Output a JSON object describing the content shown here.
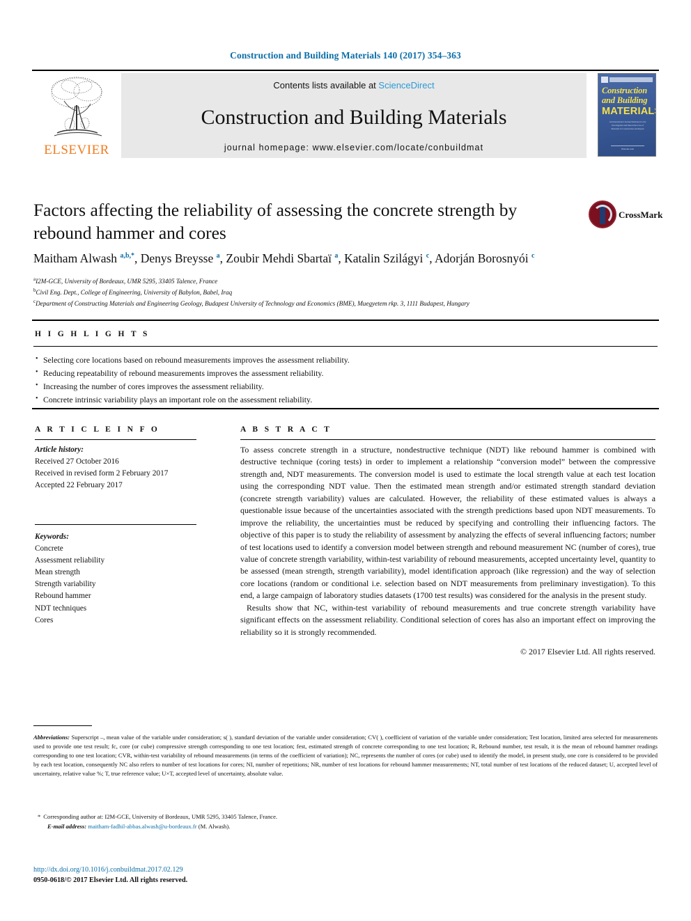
{
  "running_head": "Construction and Building Materials 140 (2017) 354–363",
  "masthead": {
    "publisher_name": "ELSEVIER",
    "contents_prefix": "Contents lists available at ",
    "contents_link": "ScienceDirect",
    "journal_title": "Construction and Building Materials",
    "homepage": "journal homepage: www.elsevier.com/locate/conbuildmat",
    "cover": {
      "line1": "Construction",
      "line2": "and Building",
      "line3": "MATERIALS",
      "blurb": "An International Journal Dedicated to the Investigation and Innovative Use of Materials in Construction and Repair",
      "bottom": "Elsevier.com"
    }
  },
  "crossmark": {
    "label": "CrossMark"
  },
  "article": {
    "title": "Factors affecting the reliability of assessing the concrete strength by rebound hammer and cores",
    "authors_html": "Maitham Alwash <sup>a,b,</sup><sup>*</sup>, Denys Breysse <sup>a</sup>, Zoubir Mehdi Sbartaï <sup>a</sup>, Katalin Szilágyi <sup>c</sup>, Adorján Borosnyói <sup>c</sup>",
    "affiliations": [
      {
        "mark": "a",
        "text": "I2M-GCE, University of Bordeaux, UMR 5295, 33405 Talence, France"
      },
      {
        "mark": "b",
        "text": "Civil Eng. Dept., College of Engineering, University of Babylon, Babel, Iraq"
      },
      {
        "mark": "c",
        "text": "Department of Constructing Materials and Engineering Geology, Budapest University of Technology and Economics (BME), Muegyetem rkp. 3, 1111 Budapest, Hungary"
      }
    ]
  },
  "highlights": {
    "heading": "H I G H L I G H T S",
    "items": [
      "Selecting core locations based on rebound measurements improves the assessment reliability.",
      "Reducing repeatability of rebound measurements improves the assessment reliability.",
      "Increasing the number of cores improves the assessment reliability.",
      "Concrete intrinsic variability plays an important role on the assessment reliability."
    ]
  },
  "article_info": {
    "heading": "A R T I C L E   I N F O",
    "history_label": "Article history:",
    "history": [
      "Received 27 October 2016",
      "Received in revised form 2 February 2017",
      "Accepted 22 February 2017"
    ],
    "keywords_label": "Keywords:",
    "keywords": [
      "Concrete",
      "Assessment reliability",
      "Mean strength",
      "Strength variability",
      "Rebound hammer",
      "NDT techniques",
      "Cores"
    ]
  },
  "abstract": {
    "heading": "A B S T R A C T",
    "paragraph1": "To assess concrete strength in a structure, nondestructive technique (NDT) like rebound hammer is combined with destructive technique (coring tests) in order to implement a relationship “conversion model” between the compressive strength and, NDT measurements. The conversion model is used to estimate the local strength value at each test location using the corresponding NDT value. Then the estimated mean strength and/or estimated strength standard deviation (concrete strength variability) values are calculated. However, the reliability of these estimated values is always a questionable issue because of the uncertainties associated with the strength predictions based upon NDT measurements. To improve the reliability, the uncertainties must be reduced by specifying and controlling their influencing factors. The objective of this paper is to study the reliability of assessment by analyzing the effects of several influencing factors; number of test locations used to identify a conversion model between strength and rebound measurement NC (number of cores), true value of concrete strength variability, within-test variability of rebound measurements, accepted uncertainty level, quantity to be assessed (mean strength, strength variability), model identification approach (like regression) and the way of selection core locations (random or conditional i.e. selection based on NDT measurements from preliminary investigation). To this end, a large campaign of laboratory studies datasets (1700 test results) was considered for the analysis in the present study.",
    "paragraph2": "Results show that NC, within-test variability of rebound measurements and true concrete strength variability have significant effects on the assessment reliability. Conditional selection of cores has also an important effect on improving the reliability so it is strongly recommended.",
    "copyright": "© 2017 Elsevier Ltd. All rights reserved."
  },
  "footnotes": {
    "abbreviations_label": "Abbreviations:",
    "abbreviations_text": "Superscript –, mean value of the variable under consideration; s( ), standard deviation of the variable under consideration; CV( ), coefficient of variation of the variable under consideration; Test location, limited area selected for measurements used to provide one test result; fc, core (or cube) compressive strength corresponding to one test location; fest, estimated strength of concrete corresponding to one test location; R, Rebound number, test result, it is the mean of rebound hammer readings corresponding to one test location; CVR, within-test variability of rebound measurements (in terms of the coefficient of variation); NC, represents the number of cores (or cube) used to identify the model, in present study, one core is considered to be provided by each test location, consequently NC also refers to number of test locations for cores; NI, number of repetitions; NR, number of test locations for rebound hammer measurements; NT, total number of test locations of the reduced dataset; U, accepted level of uncertainty, relative value %; T, true reference value; U×T, accepted level of uncertainty, absolute value.",
    "corresponding": "Corresponding author at: I2M-GCE, University of Bordeaux, UMR 5295, 33405 Talence, France.",
    "email_label": "E-mail address:",
    "email": "maitham-fadhil-abbas.alwash@u-bordeaux.fr",
    "email_suffix": "(M. Alwash)."
  },
  "doi": {
    "url": "http://dx.doi.org/10.1016/j.conbuildmat.2017.02.129",
    "issn_line": "0950-0618/© 2017 Elsevier Ltd. All rights reserved."
  },
  "colors": {
    "link": "#0b6ea8",
    "sciencedirect": "#2b9ad6",
    "elsevier_orange": "#ef7d21",
    "cover_blue": "#3c5c9a",
    "cover_yellow": "#f6e04a"
  }
}
